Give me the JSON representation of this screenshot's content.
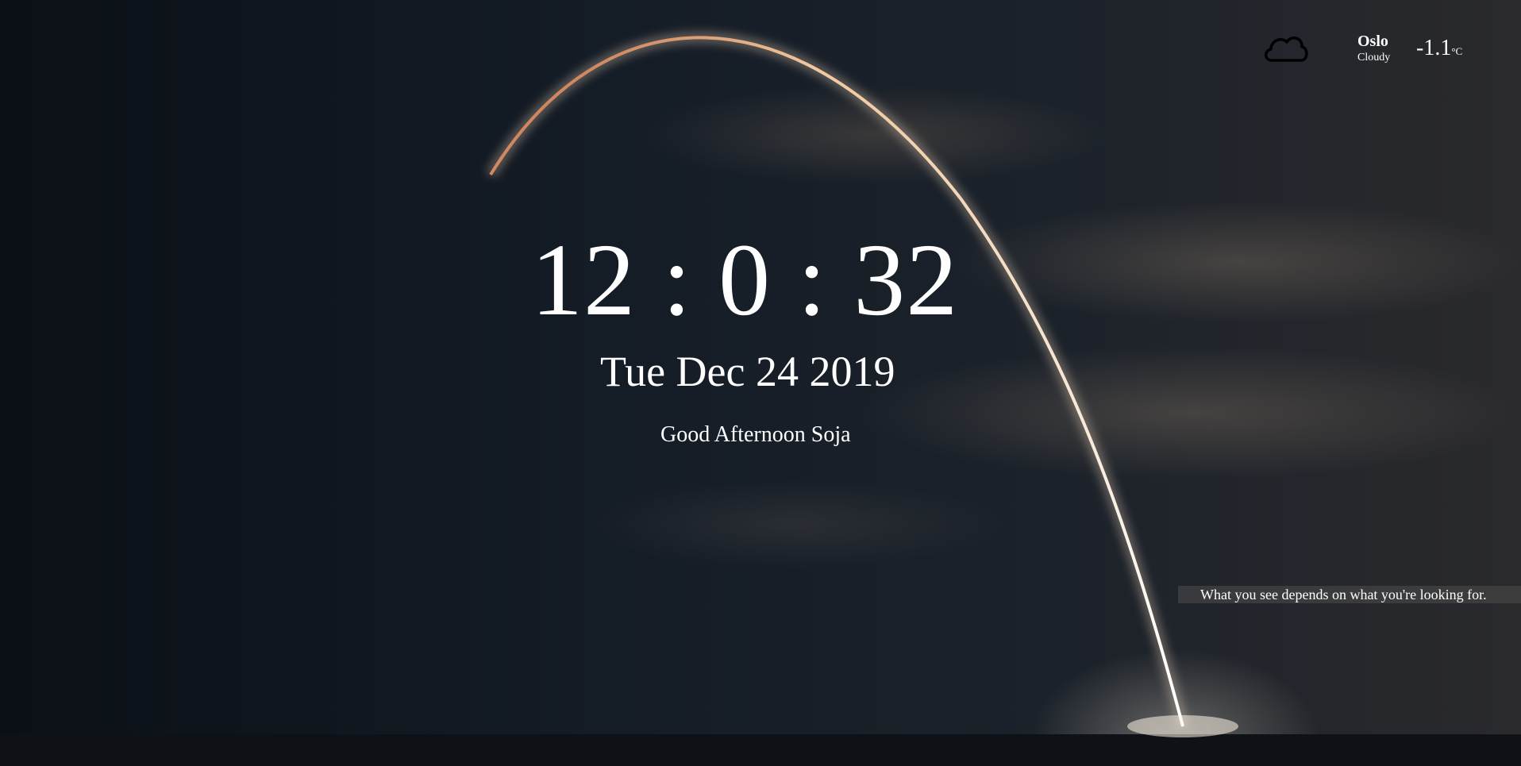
{
  "weather": {
    "icon": "cloud-icon",
    "city": "Oslo",
    "condition": "Cloudy",
    "temperature": "-1.1",
    "unit": "°C"
  },
  "clock": {
    "time": "12 : 0 : 32"
  },
  "date": "Tue Dec 24 2019",
  "greeting": "Good Afternoon Soja",
  "quote": "What you see depends on what you're looking for.",
  "colors": {
    "text": "#ffffff",
    "quote_background": "#464646",
    "sky": "#141c26"
  }
}
